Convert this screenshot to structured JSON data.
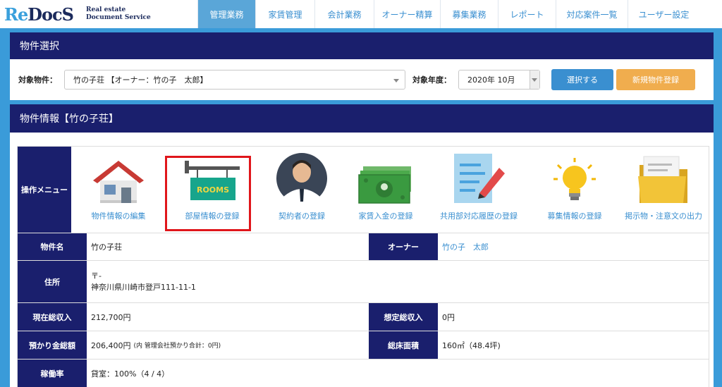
{
  "logo": {
    "re": "Re",
    "docs": "DocS",
    "sub_line1": "Real estate",
    "sub_line2": "Document Service"
  },
  "nav": [
    {
      "label": "管理業務",
      "active": true
    },
    {
      "label": "家賃管理",
      "active": false
    },
    {
      "label": "会計業務",
      "active": false
    },
    {
      "label": "オーナー精算",
      "active": false
    },
    {
      "label": "募集業務",
      "active": false
    },
    {
      "label": "レポート",
      "active": false
    },
    {
      "label": "対応案件一覧",
      "active": false
    },
    {
      "label": "ユーザー設定",
      "active": false
    }
  ],
  "property_select": {
    "title": "物件選択",
    "property_label": "対象物件：",
    "property_value": "竹の子荘 【オーナー：竹の子　太郎】",
    "year_label": "対象年度：",
    "year_value": "2020年 10月",
    "select_button": "選択する",
    "new_button": "新規物件登録"
  },
  "property_info": {
    "title": "物件情報【竹の子荘】",
    "menu_label": "操作メニュー",
    "menu_items": [
      {
        "label": "物件情報の編集",
        "icon": "house-icon"
      },
      {
        "label": "部屋情報の登録",
        "icon": "rooms-sign-icon"
      },
      {
        "label": "契約者の登録",
        "icon": "person-icon"
      },
      {
        "label": "家賃入金の登録",
        "icon": "money-icon"
      },
      {
        "label": "共用部対応履歴の登録",
        "icon": "document-pen-icon"
      },
      {
        "label": "募集情報の登録",
        "icon": "lightbulb-icon"
      },
      {
        "label": "掲示物・注意文の出力",
        "icon": "folder-icon"
      }
    ],
    "rooms_sign_text": "ROOMS",
    "rows": {
      "name_label": "物件名",
      "name_value": "竹の子荘",
      "owner_label": "オーナー",
      "owner_value": "竹の子　太郎",
      "address_label": "住所",
      "address_postal": "〒-",
      "address_value": "神奈川県川崎市登戸111-11-1",
      "income_label": "現在総収入",
      "income_value": "212,700円",
      "expected_label": "想定総収入",
      "expected_value": "0円",
      "deposit_label": "預かり金総額",
      "deposit_value": "206,400円",
      "deposit_note": "(内 管理会社預かり合計：0円)",
      "floor_label": "総床面積",
      "floor_value": "160㎡（48.4坪)",
      "occupancy_label": "稼働率",
      "occupancy_value": "貸室：100%（4 / 4）"
    }
  },
  "colors": {
    "header_navy": "#1a1f6d",
    "accent_blue": "#3a9bd9",
    "link_blue": "#3a8fd0",
    "orange": "#f0ad4e",
    "highlight_red": "#e0161b"
  }
}
